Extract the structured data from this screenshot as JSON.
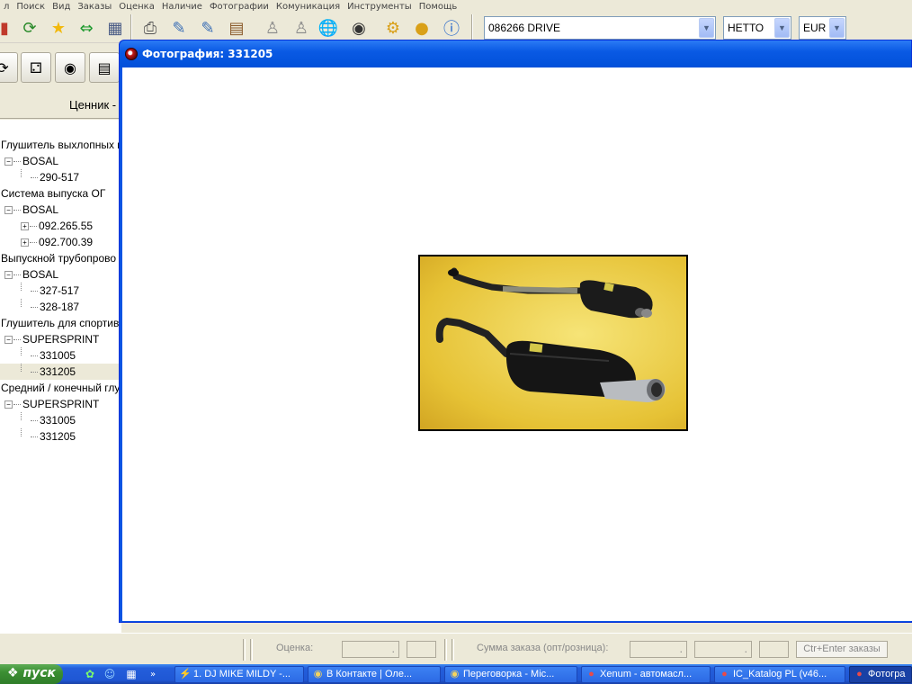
{
  "menu": [
    "л",
    "Поиск",
    "Вид",
    "Заказы",
    "Оценка",
    "Наличие",
    "Фотографии",
    "Комуникация",
    "Инструменты",
    "Помощь"
  ],
  "toolbar": {
    "icons": [
      "book-icon",
      "globe-refresh-icon",
      "star-icon",
      "arrows-icon",
      "calculator-icon",
      "printer-icon",
      "edit-icon",
      "edit-icon-2",
      "list-icon",
      "user-icon",
      "user-icon-2",
      "globe-icon",
      "camera-icon",
      "gear-icon",
      "coins-icon",
      "info-icon"
    ],
    "search_value": "086266  DRIVE",
    "price_type": "НЕТТО",
    "currency": "EUR"
  },
  "tab_label": "Ценник -",
  "tree": [
    {
      "label": "Глушитель выхлопных г",
      "level": 0
    },
    {
      "label": "BOSAL",
      "level": 1,
      "toggle": "−"
    },
    {
      "label": "290-517",
      "level": 2
    },
    {
      "label": "Система выпуска ОГ",
      "level": 0
    },
    {
      "label": "BOSAL",
      "level": 1,
      "toggle": "−"
    },
    {
      "label": "092.265.55",
      "level": 2,
      "toggle": "+"
    },
    {
      "label": "092.700.39",
      "level": 2,
      "toggle": "+"
    },
    {
      "label": "Выпускной трубопрово",
      "level": 0
    },
    {
      "label": "BOSAL",
      "level": 1,
      "toggle": "−"
    },
    {
      "label": "327-517",
      "level": 2
    },
    {
      "label": "328-187",
      "level": 2
    },
    {
      "label": "Глушитель для спортив",
      "level": 0
    },
    {
      "label": "SUPERSPRINT",
      "level": 1,
      "toggle": "−"
    },
    {
      "label": "331005",
      "level": 2
    },
    {
      "label": "331205",
      "level": 2,
      "selected": true
    },
    {
      "label": "Средний / конечный глу",
      "level": 0
    },
    {
      "label": "SUPERSPRINT",
      "level": 1,
      "toggle": "−"
    },
    {
      "label": "331005",
      "level": 2
    },
    {
      "label": "331205",
      "level": 2
    }
  ],
  "dialog": {
    "title": "Фотография:  331205"
  },
  "status": {
    "rating_label": "Оценка:",
    "rating_value": ".",
    "sum_label": "Сумма заказа (опт/розница):",
    "sum_value_1": ".",
    "sum_value_2": ".",
    "order_button": "Ctr+Enter заказы"
  },
  "taskbar": {
    "start_label": "пуск",
    "tasks": [
      {
        "label": "1. DJ MIKE MILDY -...",
        "icon": "winamp-icon"
      },
      {
        "label": "В Контакте | Оле...",
        "icon": "browser-icon"
      },
      {
        "label": "Переговорка - Mic...",
        "icon": "browser-icon"
      },
      {
        "label": "Xenum - автомасл...",
        "icon": "app-icon"
      },
      {
        "label": "IC_Katalog PL (v46...",
        "icon": "app-icon"
      },
      {
        "label": "Фотогра",
        "icon": "app-icon",
        "active": true
      }
    ]
  },
  "colors": {
    "title_bar": "#0a54e3",
    "window_bg": "#ece9d8",
    "taskbar": "#245edb",
    "start": "#3c8f33"
  }
}
